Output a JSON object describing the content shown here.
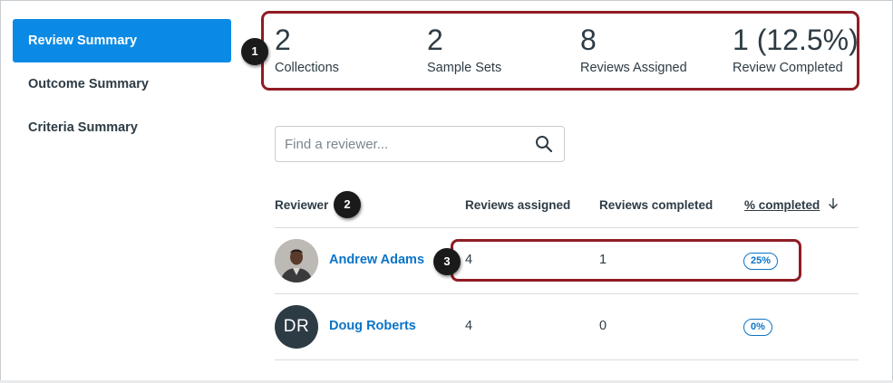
{
  "sidebar": {
    "items": [
      {
        "label": "Review Summary",
        "active": true
      },
      {
        "label": "Outcome Summary",
        "active": false
      },
      {
        "label": "Criteria Summary",
        "active": false
      }
    ]
  },
  "annotations": [
    "1",
    "2",
    "3"
  ],
  "stats": [
    {
      "value": "2",
      "label": "Collections"
    },
    {
      "value": "2",
      "label": "Sample Sets"
    },
    {
      "value": "8",
      "label": "Reviews Assigned"
    },
    {
      "value": "1 (12.5%)",
      "label": "Review Completed"
    }
  ],
  "search": {
    "placeholder": "Find a reviewer...",
    "icon": "search-icon"
  },
  "table": {
    "columns": [
      "Reviewer",
      "Reviews assigned",
      "Reviews completed",
      "% completed"
    ],
    "sort_icon": "arrow-down-icon",
    "rows": [
      {
        "avatar": "photo",
        "initials": "",
        "name": "Andrew Adams",
        "assigned": "4",
        "completed": "1",
        "percent": "25%"
      },
      {
        "avatar": "initials",
        "initials": "DR",
        "name": "Doug Roberts",
        "assigned": "4",
        "completed": "0",
        "percent": "0%"
      }
    ]
  },
  "colors": {
    "accent": "#0b8ae5",
    "link": "#0b74c8",
    "highlight_border": "#8f1c24",
    "text": "#2d3b45"
  }
}
